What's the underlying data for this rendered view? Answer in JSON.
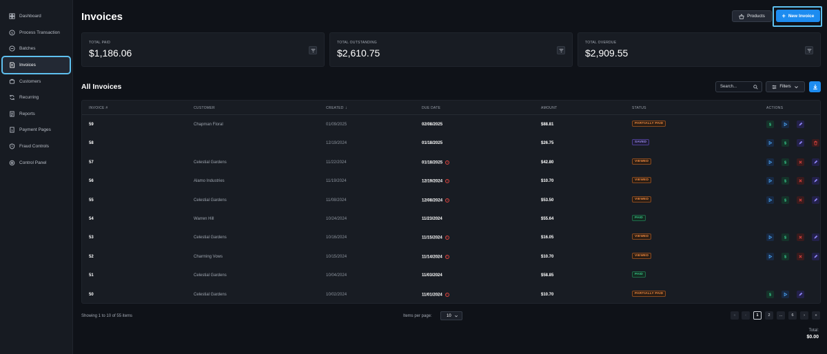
{
  "sidebar": {
    "items": [
      {
        "label": "Dashboard",
        "icon": "dashboard-icon",
        "active": false
      },
      {
        "label": "Process Transaction",
        "icon": "dollar-circle-icon",
        "active": false
      },
      {
        "label": "Batches",
        "icon": "batches-icon",
        "active": false
      },
      {
        "label": "Invoices",
        "icon": "invoice-icon",
        "active": true
      },
      {
        "label": "Customers",
        "icon": "customers-icon",
        "active": false
      },
      {
        "label": "Recurring",
        "icon": "recurring-icon",
        "active": false
      },
      {
        "label": "Reports",
        "icon": "reports-icon",
        "active": false
      },
      {
        "label": "Payment Pages",
        "icon": "payment-pages-icon",
        "active": false
      },
      {
        "label": "Fraud Controls",
        "icon": "shield-icon",
        "active": false
      },
      {
        "label": "Control Panel",
        "icon": "gear-icon",
        "active": false
      }
    ]
  },
  "header": {
    "title": "Invoices",
    "products_label": "Products",
    "new_invoice_label": "New Invoice"
  },
  "summary": [
    {
      "label": "TOTAL PAID",
      "value": "$1,186.06"
    },
    {
      "label": "TOTAL OUTSTANDING",
      "value": "$2,610.75"
    },
    {
      "label": "TOTAL OVERDUE",
      "value": "$2,909.55"
    }
  ],
  "list": {
    "title": "All Invoices",
    "search_placeholder": "Search...",
    "filters_label": "Filters"
  },
  "table": {
    "columns": {
      "invoice": "INVOICE #",
      "customer": "CUSTOMER",
      "created": "CREATED",
      "due": "DUE DATE",
      "amount": "AMOUNT",
      "status": "STATUS",
      "actions": "ACTIONS"
    },
    "rows": [
      {
        "num": "59",
        "customer": "Chapman Floral",
        "created": "01/09/2025",
        "due": "02/08/2025",
        "overdue": false,
        "amount": "$88.81",
        "status": "PARTIALLY PAID",
        "kind": "partial",
        "actions": [
          "dollar",
          "play",
          "edit"
        ]
      },
      {
        "num": "58",
        "customer": "",
        "created": "12/19/2024",
        "due": "01/18/2025",
        "overdue": false,
        "amount": "$26.75",
        "status": "SAVED",
        "kind": "saved",
        "actions": [
          "play",
          "dollar",
          "edit",
          "delete"
        ]
      },
      {
        "num": "57",
        "customer": "Celestial Gardens",
        "created": "11/22/2024",
        "due": "01/18/2025",
        "overdue": true,
        "amount": "$42.80",
        "status": "VIEWED",
        "kind": "viewed",
        "actions": [
          "play",
          "dollar",
          "x",
          "edit"
        ]
      },
      {
        "num": "56",
        "customer": "Alamo Industries",
        "created": "11/19/2024",
        "due": "12/19/2024",
        "overdue": true,
        "amount": "$10.70",
        "status": "VIEWED",
        "kind": "viewed",
        "actions": [
          "play",
          "dollar",
          "x",
          "edit"
        ]
      },
      {
        "num": "55",
        "customer": "Celestial Gardens",
        "created": "11/08/2024",
        "due": "12/08/2024",
        "overdue": true,
        "amount": "$53.50",
        "status": "VIEWED",
        "kind": "viewed",
        "actions": [
          "play",
          "dollar",
          "x",
          "edit"
        ]
      },
      {
        "num": "54",
        "customer": "Warren Hill",
        "created": "10/24/2024",
        "due": "11/23/2024",
        "overdue": false,
        "amount": "$55.64",
        "status": "PAID",
        "kind": "paid",
        "actions": []
      },
      {
        "num": "53",
        "customer": "Celestial Gardens",
        "created": "10/16/2024",
        "due": "11/15/2024",
        "overdue": true,
        "amount": "$16.05",
        "status": "VIEWED",
        "kind": "viewed",
        "actions": [
          "play",
          "dollar",
          "x",
          "edit"
        ]
      },
      {
        "num": "52",
        "customer": "Charming Vows",
        "created": "10/15/2024",
        "due": "11/14/2024",
        "overdue": true,
        "amount": "$10.70",
        "status": "VIEWED",
        "kind": "viewed",
        "actions": [
          "play",
          "dollar",
          "x",
          "edit"
        ]
      },
      {
        "num": "51",
        "customer": "Celestial Gardens",
        "created": "10/04/2024",
        "due": "11/03/2024",
        "overdue": false,
        "amount": "$58.85",
        "status": "PAID",
        "kind": "paid",
        "actions": []
      },
      {
        "num": "50",
        "customer": "Celestial Gardens",
        "created": "10/02/2024",
        "due": "11/01/2024",
        "overdue": true,
        "amount": "$10.70",
        "status": "PARTIALLY PAID",
        "kind": "partial",
        "actions": [
          "dollar",
          "play",
          "edit"
        ]
      }
    ]
  },
  "footer": {
    "showing": "Showing 1 to 10 of 55 items",
    "items_per_page_label": "Items per page:",
    "items_per_page_value": "10",
    "pages": [
      "1",
      "2",
      "...",
      "6"
    ],
    "current_page": "1",
    "total_label": "Total:",
    "total_value": "$0.00"
  },
  "colors": {
    "accent": "#1d8cf0",
    "highlight": "#5fc1f0",
    "background": "#0f1218"
  }
}
